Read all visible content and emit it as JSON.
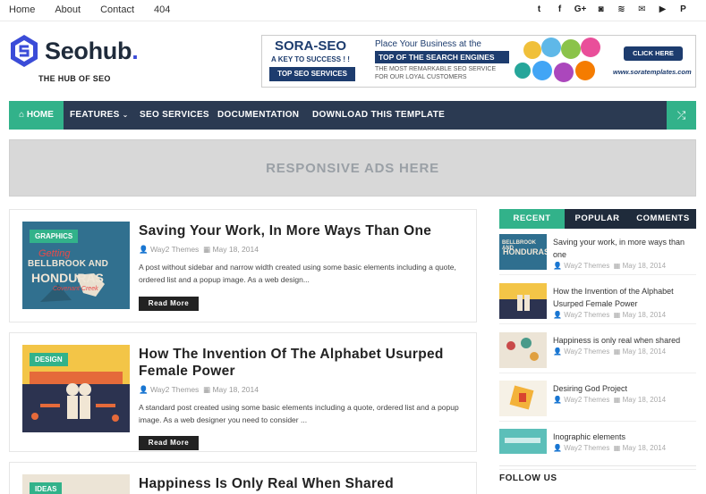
{
  "topnav": [
    "Home",
    "About",
    "Contact",
    "404"
  ],
  "social_icons": [
    {
      "name": "twitter-icon",
      "glyph": "t"
    },
    {
      "name": "facebook-icon",
      "glyph": "f"
    },
    {
      "name": "google-plus-icon",
      "glyph": "G+"
    },
    {
      "name": "instagram-icon",
      "glyph": "◙"
    },
    {
      "name": "rss-icon",
      "glyph": "≋"
    },
    {
      "name": "email-icon",
      "glyph": "✉"
    },
    {
      "name": "youtube-icon",
      "glyph": "▶"
    },
    {
      "name": "pinterest-icon",
      "glyph": "P"
    }
  ],
  "brand": {
    "name": "Seohub",
    "dot": ".",
    "tagline": "THE HUB OF SEO",
    "accent": "#3b4cd8"
  },
  "banner": {
    "sora": "SORA-SEO",
    "key": "A KEY TO SUCCESS ! !",
    "top": "TOP SEO SERVICES",
    "place": "Place Your Business at the",
    "search": "TOP OF THE SEARCH ENGINES",
    "remark": "THE MOST REMARKABLE SEO SERVICE FOR OUR LOYAL CUSTOMERS",
    "click": "CLICK HERE",
    "url": "www.soratemplates.com"
  },
  "mainnav": {
    "home": "HOME",
    "items": [
      "FEATURES",
      "SEO SERVICES",
      "DOCUMENTATION",
      "DOWNLOAD THIS TEMPLATE"
    ],
    "accent": "#32b28a",
    "bg": "#2b3a52"
  },
  "ads": {
    "text": "RESPONSIVE ADS HERE"
  },
  "posts": [
    {
      "category": "GRAPHICS",
      "title": "Saving Your Work, In More Ways Than One",
      "author": "Way2 Themes",
      "date": "May 18, 2014",
      "excerpt": "A post without sidebar and narrow width created using some basic elements including a quote, ordered list and a popup image. As a web design...",
      "more": "Read More"
    },
    {
      "category": "DESIGN",
      "title": "How The Invention Of The Alphabet Usurped Female Power",
      "author": "Way2 Themes",
      "date": "May 18, 2014",
      "excerpt": "A standard post created using some basic elements including a quote, ordered list and a popup image. As a web designer you need to consider ...",
      "more": "Read More"
    },
    {
      "category": "IDEAS",
      "title": "Happiness Is Only Real When Shared"
    }
  ],
  "sidebar": {
    "tabs": [
      "RECENT",
      "POPULAR",
      "COMMENTS"
    ],
    "recent": [
      {
        "title": "Saving your work, in more ways than one",
        "author": "Way2 Themes",
        "date": "May 18, 2014"
      },
      {
        "title": "How the Invention of the Alphabet Usurped Female Power",
        "author": "Way2 Themes",
        "date": "May 18, 2014"
      },
      {
        "title": "Happiness is only real when shared",
        "author": "Way2 Themes",
        "date": "May 18, 2014"
      },
      {
        "title": "Desiring God Project",
        "author": "Way2 Themes",
        "date": "May 18, 2014"
      },
      {
        "title": "Inographic elements",
        "author": "Way2 Themes",
        "date": "May 18, 2014"
      }
    ],
    "follow": "FOLLOW US"
  },
  "thumb1": {
    "line1": "Getting",
    "line2": "BELLBROOK AND",
    "line3": "HONDURAS",
    "line4": "Covenant Creek"
  },
  "sthumb1": {
    "line1": "BELLBROOK AND",
    "line2": "HONDURAS"
  }
}
